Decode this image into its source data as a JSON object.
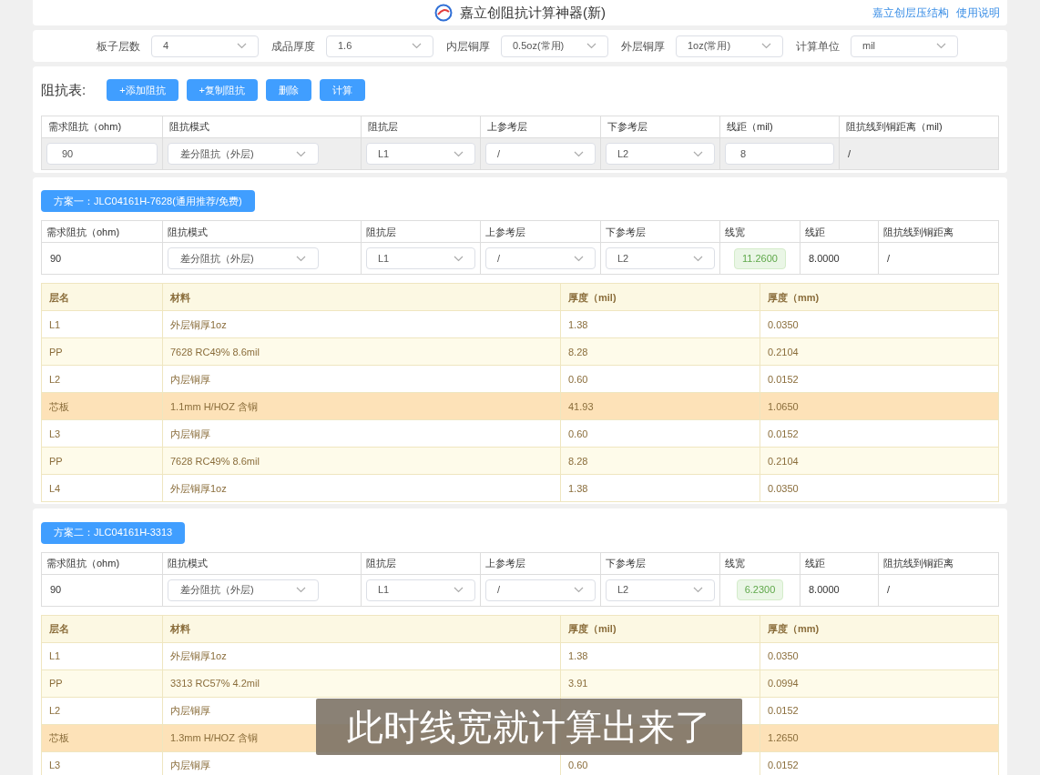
{
  "header": {
    "title": "嘉立创阻抗计算神器(新)",
    "links": [
      "嘉立创层压结构",
      "使用说明"
    ]
  },
  "settings": [
    {
      "label": "板子层数",
      "value": "4"
    },
    {
      "label": "成品厚度",
      "value": "1.6"
    },
    {
      "label": "内层铜厚",
      "value": "0.5oz(常用)"
    },
    {
      "label": "外层铜厚",
      "value": "1oz(常用)"
    },
    {
      "label": "计算单位",
      "value": "mil"
    }
  ],
  "impedance": {
    "title": "阻抗表:",
    "buttons": [
      "+添加阻抗",
      "+复制阻抗",
      "删除",
      "计算"
    ],
    "columns": [
      "需求阻抗（ohm)",
      "阻抗模式",
      "阻抗层",
      "上参考层",
      "下参考层",
      "线距（mil)",
      "阻抗线到铜距离（mil)"
    ],
    "row": [
      {
        "kind": "input",
        "value": "90"
      },
      {
        "kind": "select",
        "value": "差分阻抗（外层)"
      },
      {
        "kind": "select",
        "value": "L1"
      },
      {
        "kind": "select",
        "value": "/"
      },
      {
        "kind": "select",
        "value": "L2"
      },
      {
        "kind": "input",
        "value": "8"
      },
      {
        "kind": "text",
        "value": "/"
      }
    ]
  },
  "plans": [
    {
      "name": "方案一：JLC04161H-7628(通用推荐/免费)",
      "columns": [
        "需求阻抗（ohm)",
        "阻抗模式",
        "阻抗层",
        "上参考层",
        "下参考层",
        "线宽",
        "线距",
        "阻抗线到铜距离"
      ],
      "row": [
        {
          "kind": "text",
          "value": "90"
        },
        {
          "kind": "select",
          "value": "差分阻抗（外层)"
        },
        {
          "kind": "select",
          "value": "L1"
        },
        {
          "kind": "select",
          "value": "/"
        },
        {
          "kind": "select",
          "value": "L2"
        },
        {
          "kind": "result",
          "value": "11.2600"
        },
        {
          "kind": "text",
          "value": "8.0000"
        },
        {
          "kind": "text",
          "value": "/"
        }
      ],
      "stack_columns": [
        "层名",
        "材料",
        "厚度（mil)",
        "厚度（mm)"
      ],
      "layers": [
        {
          "kind": "copper",
          "name": "L1",
          "material": "外层铜厚1oz",
          "mil": "1.38",
          "mm": "0.0350"
        },
        {
          "kind": "pp",
          "name": "PP",
          "material": "7628 RC49% 8.6mil",
          "mil": "8.28",
          "mm": "0.2104"
        },
        {
          "kind": "copper",
          "name": "L2",
          "material": "内层铜厚",
          "mil": "0.60",
          "mm": "0.0152"
        },
        {
          "kind": "core",
          "name": "芯板",
          "material": "1.1mm H/HOZ 含铜",
          "mil": "41.93",
          "mm": "1.0650"
        },
        {
          "kind": "copper",
          "name": "L3",
          "material": "内层铜厚",
          "mil": "0.60",
          "mm": "0.0152"
        },
        {
          "kind": "pp",
          "name": "PP",
          "material": "7628 RC49% 8.6mil",
          "mil": "8.28",
          "mm": "0.2104"
        },
        {
          "kind": "copper",
          "name": "L4",
          "material": "外层铜厚1oz",
          "mil": "1.38",
          "mm": "0.0350"
        }
      ]
    },
    {
      "name": "方案二：JLC04161H-3313",
      "columns": [
        "需求阻抗（ohm)",
        "阻抗模式",
        "阻抗层",
        "上参考层",
        "下参考层",
        "线宽",
        "线距",
        "阻抗线到铜距离"
      ],
      "row": [
        {
          "kind": "text",
          "value": "90"
        },
        {
          "kind": "select",
          "value": "差分阻抗（外层)"
        },
        {
          "kind": "select",
          "value": "L1"
        },
        {
          "kind": "select",
          "value": "/"
        },
        {
          "kind": "select",
          "value": "L2"
        },
        {
          "kind": "result",
          "value": "6.2300"
        },
        {
          "kind": "text",
          "value": "8.0000"
        },
        {
          "kind": "text",
          "value": "/"
        }
      ],
      "stack_columns": [
        "层名",
        "材料",
        "厚度（mil)",
        "厚度（mm)"
      ],
      "layers": [
        {
          "kind": "copper",
          "name": "L1",
          "material": "外层铜厚1oz",
          "mil": "1.38",
          "mm": "0.0350"
        },
        {
          "kind": "pp",
          "name": "PP",
          "material": "3313 RC57% 4.2mil",
          "mil": "3.91",
          "mm": "0.0994"
        },
        {
          "kind": "copper",
          "name": "L2",
          "material": "内层铜厚",
          "mm": "0.0152"
        },
        {
          "kind": "core",
          "name": "芯板",
          "material": "1.3mm H/HOZ 含铜",
          "mm": "1.2650"
        },
        {
          "kind": "copper",
          "name": "L3",
          "material": "内层铜厚",
          "mil": "0.60",
          "mm": "0.0152"
        }
      ]
    }
  ],
  "caption": "此时线宽就计算出来了"
}
